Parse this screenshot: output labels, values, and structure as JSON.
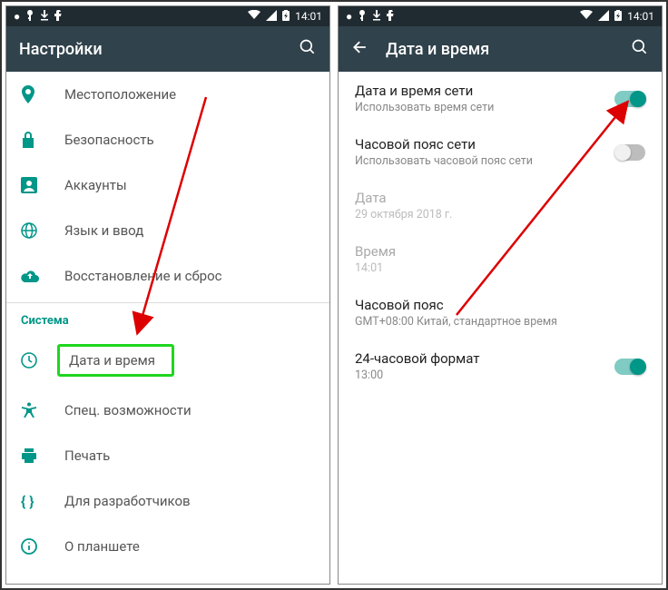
{
  "statusbar": {
    "time": "14:01"
  },
  "phone1": {
    "title": "Настройки",
    "items": {
      "location": "Местоположение",
      "security": "Безопасность",
      "accounts": "Аккаунты",
      "language": "Язык и ввод",
      "backup": "Восстановление и сброс"
    },
    "section": "Система",
    "system_items": {
      "datetime": "Дата и время",
      "accessibility": "Спец. возможности",
      "print": "Печать",
      "dev": "Для разработчиков",
      "about": "О планшете"
    }
  },
  "phone2": {
    "title": "Дата и время",
    "auto_dt": {
      "title": "Дата и время сети",
      "sub": "Использовать время сети",
      "on": true
    },
    "auto_tz": {
      "title": "Часовой пояс сети",
      "sub": "Использовать часовой пояс сети",
      "on": false
    },
    "date": {
      "title": "Дата",
      "sub": "29 октября 2018 г.",
      "disabled": true
    },
    "time": {
      "title": "Время",
      "sub": "14:01",
      "disabled": true
    },
    "tz": {
      "title": "Часовой пояс",
      "sub": "GMT+08:00 Китай, стандартное время"
    },
    "h24": {
      "title": "24-часовой формат",
      "sub": "13:00",
      "on": true
    }
  }
}
